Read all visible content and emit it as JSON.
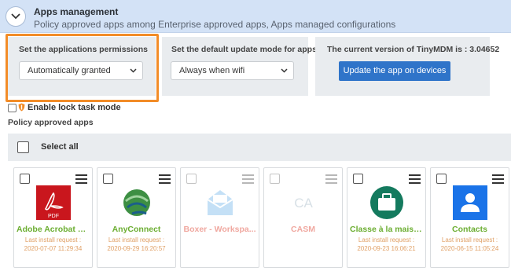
{
  "header": {
    "title": "Apps management",
    "subtitle": "Policy approved apps among Enterprise approved apps, Apps managed configurations"
  },
  "permissions": {
    "label": "Set the applications permissions",
    "value": "Automatically granted"
  },
  "update_mode": {
    "label": "Set the default update mode for apps",
    "value": "Always when wifi"
  },
  "version": {
    "label": "The current version of TinyMDM is : 3.04652",
    "button": "Update the app on devices"
  },
  "lock_task": {
    "label": "Enable lock task mode"
  },
  "policy_apps_label": "Policy approved apps",
  "select_all": "Select all",
  "apps": [
    {
      "name": "Adobe Acrobat R...",
      "meta_label": "Last install request :",
      "date": "2020-07-07 11:29:34",
      "icon": "adobe-pdf-icon"
    },
    {
      "name": "AnyConnect",
      "meta_label": "Last install request :",
      "date": "2020-09-29 16:20:57",
      "icon": "anyconnect-icon"
    },
    {
      "name": "Boxer - Workspa...",
      "meta_label": "",
      "date": "",
      "icon": "boxer-mail-icon"
    },
    {
      "name": "CASM",
      "meta_label": "",
      "date": "",
      "icon": "casm-icon"
    },
    {
      "name": "Classe à la maison",
      "meta_label": "Last install request :",
      "date": "2020-09-23 16:06:21",
      "icon": "briefcase-icon"
    },
    {
      "name": "Contacts",
      "meta_label": "Last install request :",
      "date": "2020-06-15 11:05:24",
      "icon": "contacts-icon"
    }
  ],
  "colors": {
    "header_bg": "#d3e2f6",
    "panel_bg": "#e9ecef",
    "highlight_outline": "#f28c28",
    "button_bg": "#2f74c9",
    "app_name": "#6cae32",
    "meta_text": "#e0a066"
  }
}
